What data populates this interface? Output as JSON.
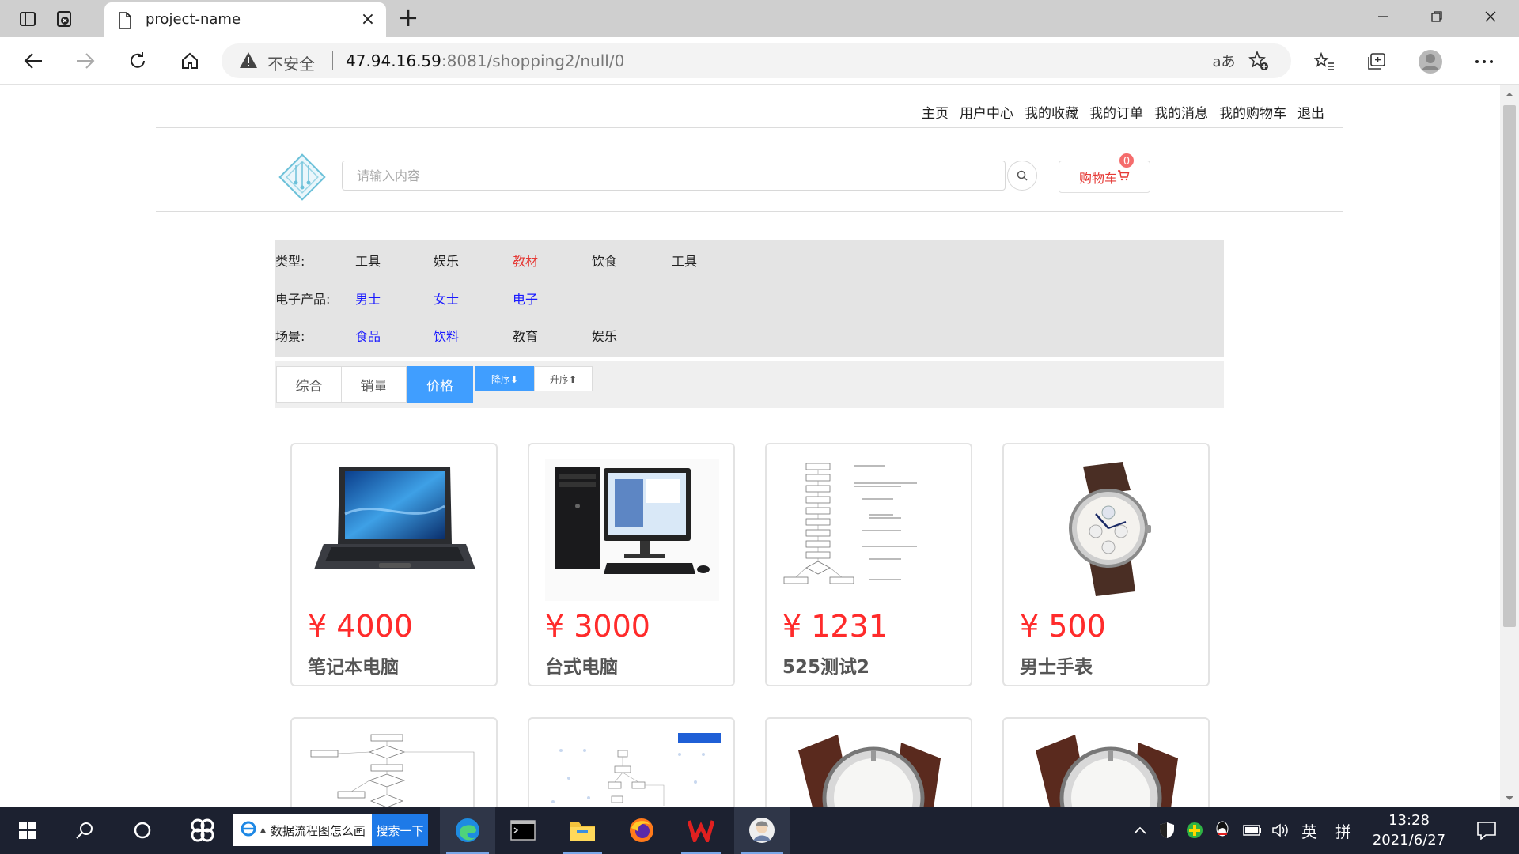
{
  "browser": {
    "tab_title": "project-name",
    "tab_close": "×",
    "new_tab": "+",
    "security_label": "不安全",
    "url_host": "47.94.16.59",
    "url_rest": ":8081/shopping2/null/0",
    "read_aloud": "aあ"
  },
  "top_nav": [
    "主页",
    "用户中心",
    "我的收藏",
    "我的订单",
    "我的消息",
    "我的购物车",
    "退出"
  ],
  "search": {
    "placeholder": "请输入内容"
  },
  "cart": {
    "label": "购物车",
    "count": "0"
  },
  "filters": [
    {
      "label": "类型:",
      "values": [
        {
          "text": "工具",
          "color": "black"
        },
        {
          "text": "娱乐",
          "color": "black"
        },
        {
          "text": "教材",
          "color": "red"
        },
        {
          "text": "饮食",
          "color": "black"
        },
        {
          "text": "工具",
          "color": "black"
        }
      ]
    },
    {
      "label": "电子产品:",
      "values": [
        {
          "text": "男士",
          "color": "blue"
        },
        {
          "text": "女士",
          "color": "blue"
        },
        {
          "text": "电子",
          "color": "blue"
        }
      ]
    },
    {
      "label": "场景:",
      "values": [
        {
          "text": "食品",
          "color": "blue"
        },
        {
          "text": "饮料",
          "color": "blue"
        },
        {
          "text": "教育",
          "color": "black"
        },
        {
          "text": "娱乐",
          "color": "black"
        }
      ]
    }
  ],
  "sort": {
    "tabs": [
      "综合",
      "销量",
      "价格"
    ],
    "active_tab": "价格",
    "order": [
      "降序⬇",
      "升序⬆"
    ],
    "active_order": "降序⬇"
  },
  "products": [
    {
      "price": "¥ 4000",
      "name": "笔记本电脑",
      "image": "laptop"
    },
    {
      "price": "¥ 3000",
      "name": "台式电脑",
      "image": "desktop-computer"
    },
    {
      "price": "¥ 1231",
      "name": "525测试2",
      "image": "flowchart"
    },
    {
      "price": "¥ 500",
      "name": "男士手表",
      "image": "wristwatch"
    }
  ],
  "taskbar": {
    "search_text": "数据流程图怎么画",
    "search_button": "搜索一下",
    "ime": "英",
    "ime2": "拼",
    "time": "13:28",
    "date": "2021/6/27"
  },
  "colors": {
    "accent": "#409eff",
    "price": "#ff2b2b",
    "link_blue": "#1a1aff",
    "active_red": "#e53935"
  }
}
